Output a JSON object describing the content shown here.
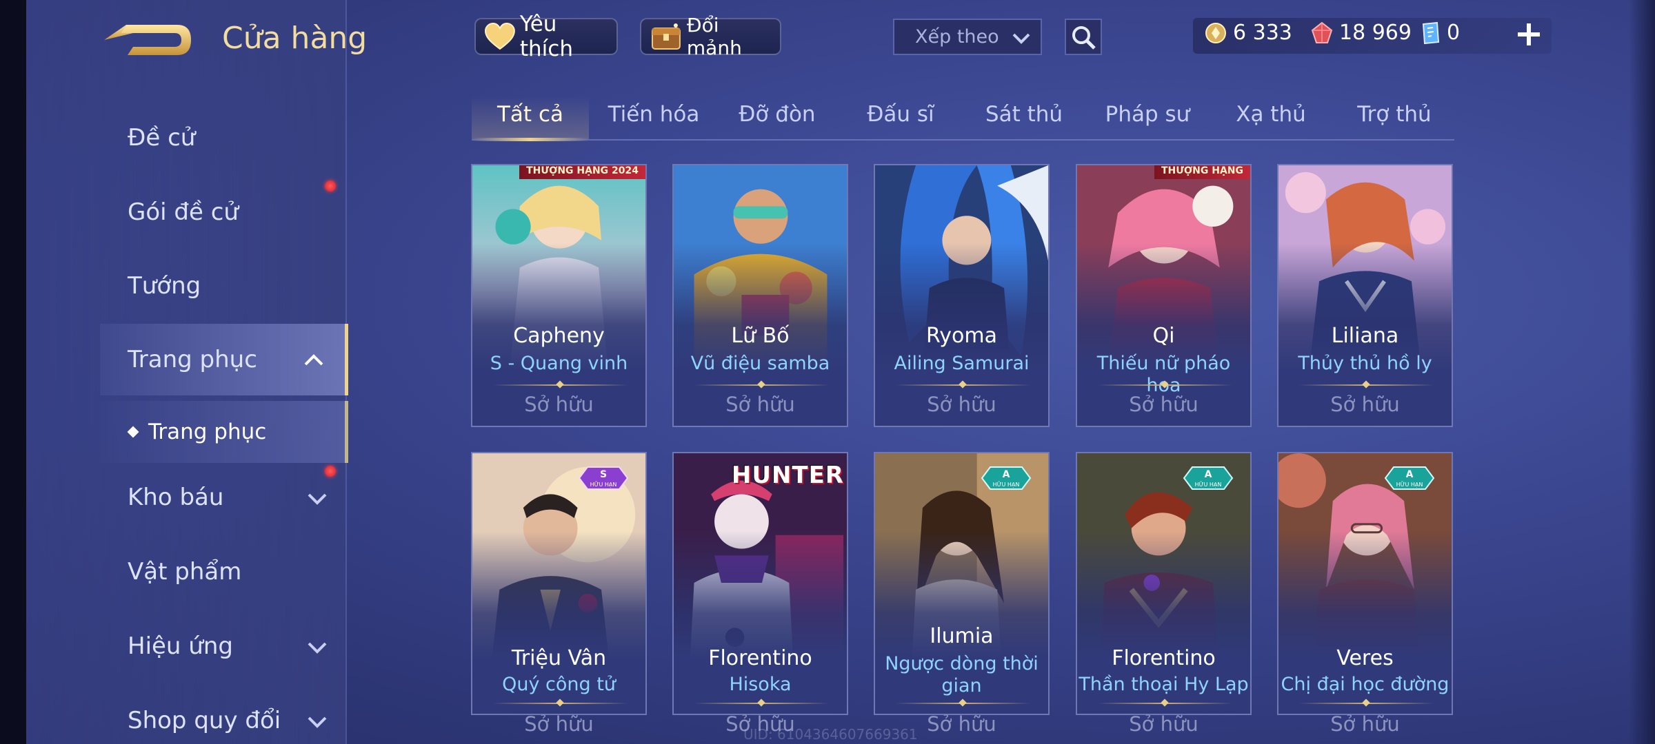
{
  "header": {
    "title": "Cửa hàng",
    "favorites_label": "Yêu thích",
    "shards_label": "Đổi mảnh",
    "sort_placeholder": "Xếp theo",
    "currencies": [
      {
        "name": "gold-coin-icon",
        "value": "6 333"
      },
      {
        "name": "ruby-gem-icon",
        "value": "18 969"
      },
      {
        "name": "voucher-icon",
        "value": "0"
      }
    ]
  },
  "sidebar": {
    "items": [
      {
        "label": "Đề cử"
      },
      {
        "label": "Gói đề cử"
      },
      {
        "label": "Tướng"
      },
      {
        "label": "Trang phục"
      },
      {
        "label": "Kho báu"
      },
      {
        "label": "Vật phẩm"
      },
      {
        "label": "Hiệu ứng"
      },
      {
        "label": "Shop quy đổi"
      }
    ],
    "sub_item": "Trang phục"
  },
  "tabs": [
    "Tất cả",
    "Tiến hóa",
    "Đỡ đòn",
    "Đấu sĩ",
    "Sát thủ",
    "Pháp sư",
    "Xạ thủ",
    "Trợ thủ"
  ],
  "skins": [
    {
      "hero": "Capheny",
      "skin": "S - Quang vinh",
      "status": "Sở hữu",
      "badge": "THƯỢNG HẠNG 2024"
    },
    {
      "hero": "Lữ Bố",
      "skin": "Vũ điệu samba",
      "status": "Sở hữu"
    },
    {
      "hero": "Ryoma",
      "skin": "Ailing Samurai",
      "status": "Sở hữu"
    },
    {
      "hero": "Qi",
      "skin": "Thiếu nữ pháo hoa",
      "status": "Sở hữu",
      "badge": "THƯỢNG HẠNG"
    },
    {
      "hero": "Liliana",
      "skin": "Thủy thủ hồ ly",
      "status": "Sở hữu"
    },
    {
      "hero": "Triệu Vân",
      "skin": "Quý công tử",
      "status": "Sở hữu",
      "tier": "S",
      "tier_sub": "HỮU HẠN"
    },
    {
      "hero": "Florentino",
      "skin": "Hisoka",
      "status": "Sở hữu",
      "logo": "HUNTER"
    },
    {
      "hero": "Ilumia",
      "skin": "Ngược dòng thời",
      "skin2": "gian",
      "status": "Sở hữu",
      "tier": "A",
      "tier_sub": "HỮU HẠN"
    },
    {
      "hero": "Florentino",
      "skin": "Thần thoại Hy Lạp",
      "status": "Sở hữu",
      "tier": "A",
      "tier_sub": "HỮU HẠN"
    },
    {
      "hero": "Veres",
      "skin": "Chị đại học đường",
      "status": "Sở hữu",
      "tier": "A",
      "tier_sub": "HỮU HẠN"
    }
  ],
  "footer": {
    "uid": "UID: 6104364607669361"
  },
  "colors": {
    "accent_gold": "#f0d489",
    "skin_name": "#8fd3ff",
    "badge_red": "#d21e2e"
  }
}
